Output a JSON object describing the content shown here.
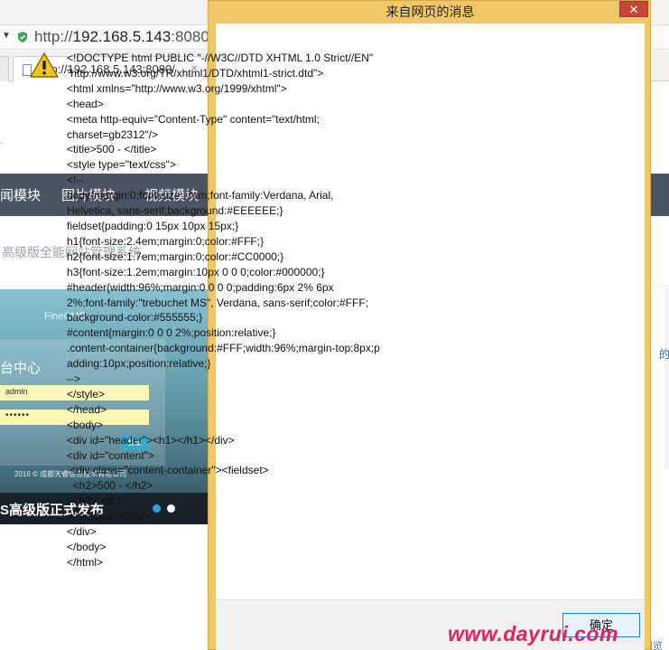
{
  "browser": {
    "address_url_prefix": "http://",
    "address_url_host": "192.168.5.143",
    "address_url_port": ":8080/",
    "tab_title": "http://192.168.5.143:8080/",
    "tab_close": "×"
  },
  "site": {
    "nav_items": [
      "闻模块",
      "图片模块",
      "视频模块"
    ],
    "subtitle": "高级版全能网站管理系统",
    "slide": {
      "brand": "FineCMS",
      "panel_title": "台中心",
      "username": "admin",
      "password_mask": "••••••",
      "login_label": "登录",
      "copyright": "2016 © 成都天睿信息技术有限公司",
      "caption": "S高级版正式发布"
    },
    "side_text_right": "的",
    "side_text_bottom": "浏览"
  },
  "dialog": {
    "title": "来自网页的消息",
    "close_label": "✕",
    "ok_label": "确定",
    "message_lines": [
      "<!DOCTYPE html PUBLIC \"-//W3C//DTD XHTML 1.0 Strict//EN\"",
      "\"http://www.w3.org/TR/xhtml1/DTD/xhtml1-strict.dtd\">",
      "<html xmlns=\"http://www.w3.org/1999/xhtml\">",
      "<head>",
      "<meta http-equiv=\"Content-Type\" content=\"text/html;",
      "charset=gb2312\"/>",
      "<title>500 - </title>",
      "<style type=\"text/css\">",
      "<!--",
      "body{margin:0;font-size:.7em;font-family:Verdana, Arial,",
      "Helvetica, sans-serif;background:#EEEEEE;}",
      "fieldset{padding:0 15px 10px 15px;}",
      "h1{font-size:2.4em;margin:0;color:#FFF;}",
      "h2{font-size:1.7em;margin:0;color:#CC0000;}",
      "h3{font-size:1.2em;margin:10px 0 0 0;color:#000000;}",
      "#header{width:96%;margin:0 0 0 0;padding:6px 2% 6px",
      "2%;font-family:\"trebuchet MS\", Verdana, sans-serif;color:#FFF;",
      "background-color:#555555;}",
      "#content{margin:0 0 0 2%;position:relative;}",
      ".content-container{background:#FFF;width:96%;margin-top:8px;p",
      "adding:10px;position:relative;}",
      "-->",
      "</style>",
      "</head>",
      "<body>",
      "<div id=\"header\"><h1></h1></div>",
      "<div id=\"content\">",
      " <div class=\"content-container\"><fieldset>",
      "  <h2>500 - </h2>",
      "  <h3>'</h3>",
      " </fieldset></div>",
      "</div>",
      "</body>",
      "</html>"
    ]
  },
  "watermark": "www.dayrui.com",
  "colors": {
    "dialog_frame": "#f0c868",
    "nav_bg": "#4b5461",
    "close_red": "#c7463c",
    "watermark": "#e0245e"
  }
}
